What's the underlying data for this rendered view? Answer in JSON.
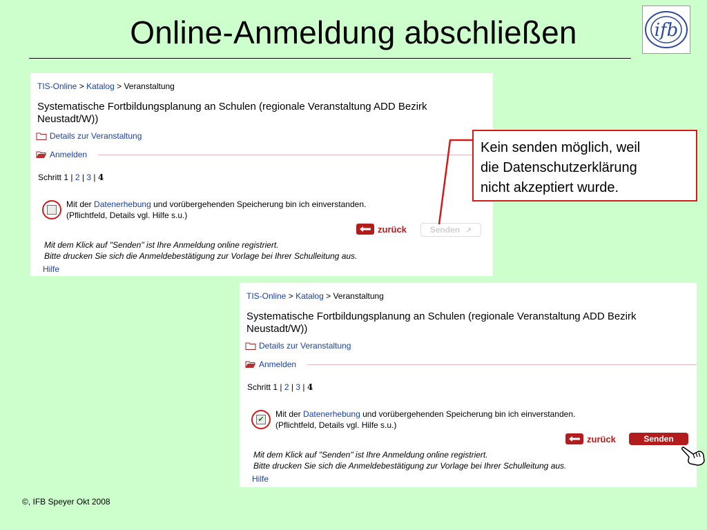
{
  "slide": {
    "title": "Online-Anmeldung abschließen",
    "footer": "©, IFB Speyer  Okt 2008",
    "logo_text": "ifb",
    "callout": {
      "line1": "Kein senden möglich, weil",
      "line2": "die Datenschutzerklärung",
      "line3": "nicht akzeptiert wurde."
    }
  },
  "form": {
    "breadcrumb": {
      "home": "TIS-Online",
      "sep": ">",
      "catalog": "Katalog",
      "current": "Veranstaltung"
    },
    "event_title": "Systematische Fortbildungsplanung an Schulen (regionale Veranstaltung ADD Bezirk Neustadt/W))",
    "details_link": "Details zur Veranstaltung",
    "register_section": "Anmelden",
    "steps": {
      "label": "Schritt 1",
      "step2": "2",
      "step3": "3",
      "step4": "4",
      "divider": "|"
    },
    "consent": {
      "prefix": "Mit der",
      "link": "Datenerhebung",
      "suffix": "und vorübergehenden Speicherung bin ich einverstanden.",
      "note": "(Pflichtfeld, Details vgl. Hilfe s.u.)"
    },
    "back_label": "zurück",
    "send_label": "Senden",
    "info_line1": "Mit dem Klick auf \"Senden\" ist Ihre Anmeldung online registriert.",
    "info_line2": "Bitte drucken Sie sich die Anmeldebestätigung zur Vorlage bei Ihrer Schulleitung aus.",
    "help_link": "Hilfe"
  },
  "states": {
    "panel1": {
      "checked": false,
      "send_enabled": false
    },
    "panel2": {
      "checked": true,
      "send_enabled": true
    }
  },
  "colors": {
    "background": "#ccffcc",
    "accent_red": "#b21c1c",
    "link_blue": "#1a3fa8",
    "callout_border": "#d21a1a"
  }
}
